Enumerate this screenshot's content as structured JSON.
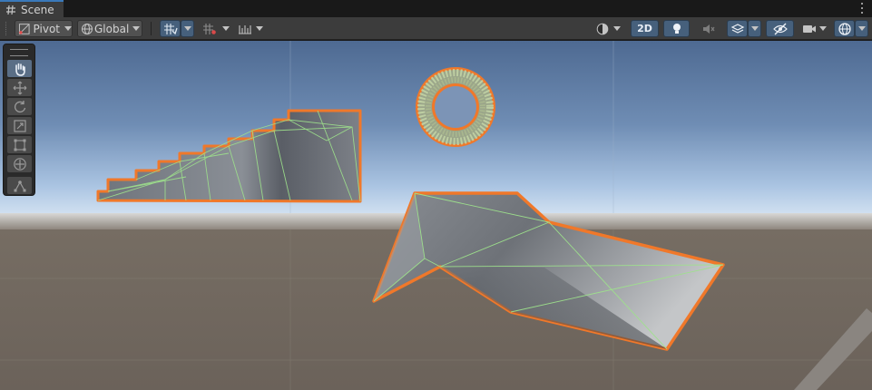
{
  "tab": {
    "label": "Scene",
    "icon": "hash-grid-icon"
  },
  "toolbar": {
    "pivot_label": "Pivot",
    "global_label": "Global",
    "mode_2d_label": "2D",
    "left_icons": [
      "pivot-icon",
      "global-globe-icon",
      "grid-snap-icon",
      "increment-snap-icon",
      "ruler-icon"
    ],
    "right_icons": [
      "draw-mode-icon",
      "lighting-bulb-icon",
      "audio-mute-icon",
      "effects-layers-icon",
      "hidden-eye-icon",
      "camera-icon",
      "gizmos-icon"
    ]
  },
  "tools": {
    "items": [
      "hand-tool",
      "move-tool",
      "rotate-tool",
      "scale-tool",
      "rect-tool",
      "transform-tool",
      "custom-tool"
    ],
    "active": "hand-tool"
  },
  "colors": {
    "selection_outline": "#f0782a",
    "wireframe": "#9ee28c",
    "sky_horizon": "#cfe0f0",
    "ground": "#6e655d",
    "active_button": "#46607c"
  }
}
